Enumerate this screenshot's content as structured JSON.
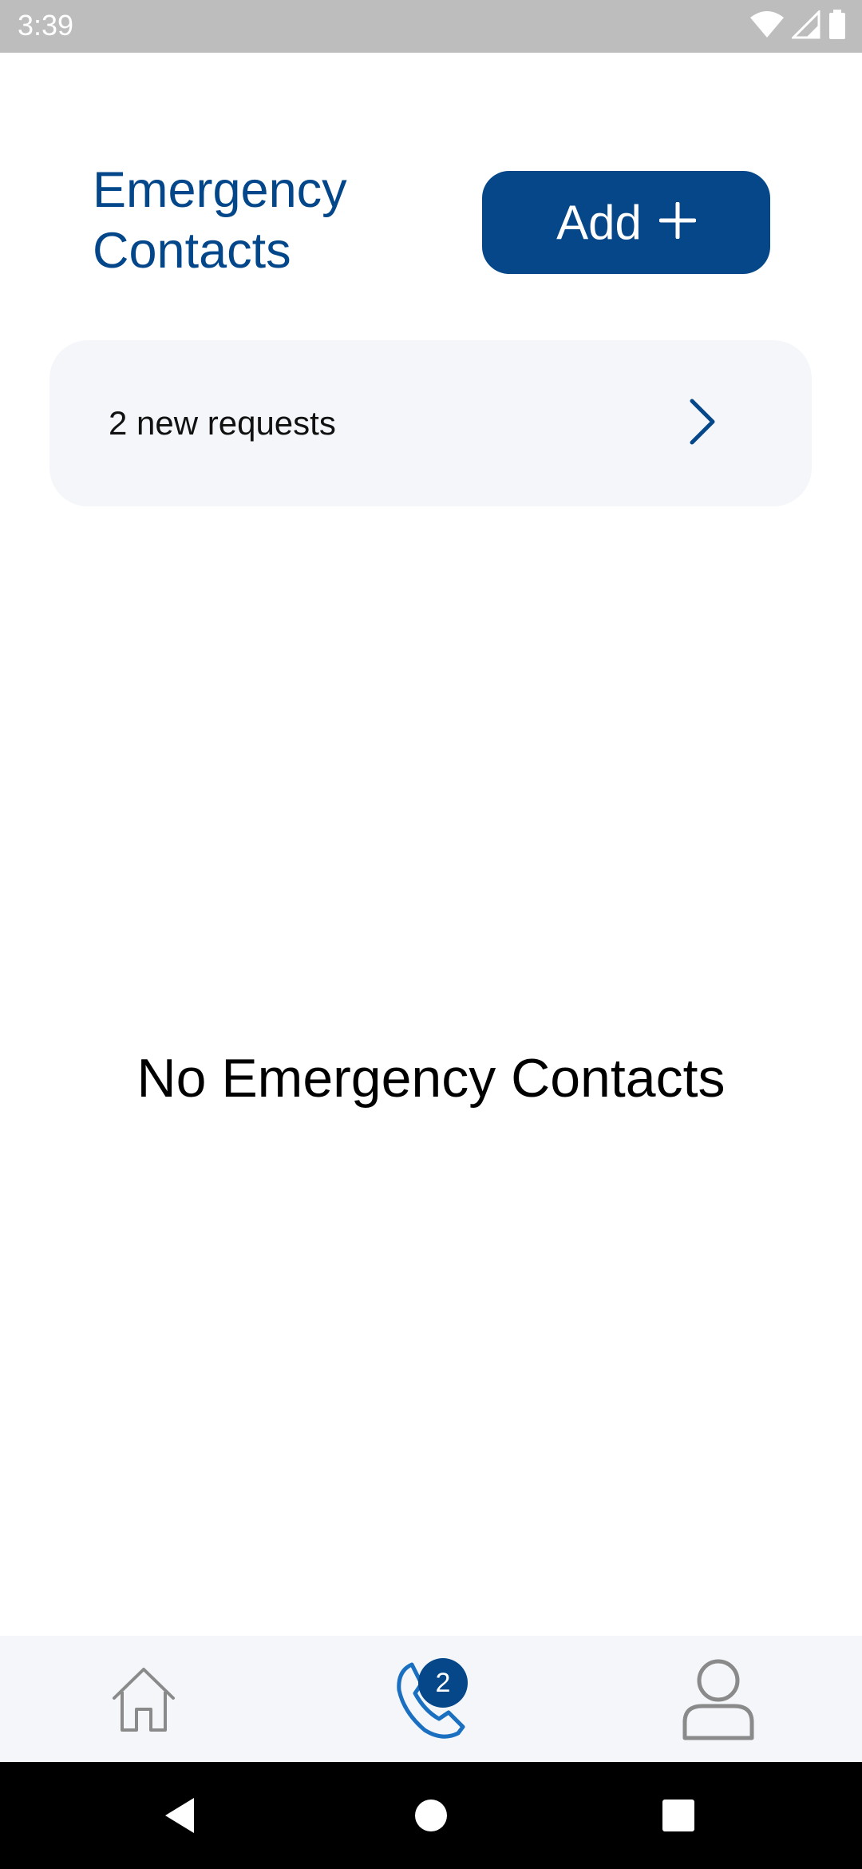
{
  "status_bar": {
    "time": "3:39",
    "icons": [
      "wifi-icon",
      "signal-icon",
      "battery-icon"
    ]
  },
  "header": {
    "title": "Emergency Contacts",
    "add_label": "Add",
    "add_icon": "plus-icon"
  },
  "requests": {
    "label": "2 new requests",
    "icon": "chevron-right-icon"
  },
  "empty_state": {
    "message": "No Emergency Contacts"
  },
  "bottom_nav": {
    "items": [
      {
        "icon": "home-icon",
        "active": false
      },
      {
        "icon": "phone-icon",
        "active": true,
        "badge": "2"
      },
      {
        "icon": "user-icon",
        "active": false
      }
    ]
  },
  "system_nav": {
    "buttons": [
      "back-icon",
      "home-circle-icon",
      "recents-icon"
    ]
  },
  "colors": {
    "brand": "#054788",
    "title": "#03478a",
    "card_bg": "#f4f6fa",
    "status_bar": "#bdbdbd",
    "icon_inactive": "#8a8a8a",
    "icon_active": "#1a6fc0"
  }
}
